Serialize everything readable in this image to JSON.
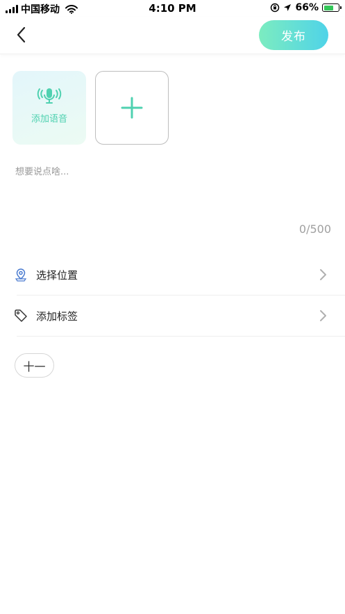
{
  "status_bar": {
    "carrier": "中国移动",
    "time": "4:10 PM",
    "battery_percent": "66%",
    "battery_level": 0.66,
    "icons": [
      "signal-icon",
      "wifi-icon",
      "orientation-lock-icon",
      "location-arrow-icon",
      "battery-icon"
    ]
  },
  "nav": {
    "back_icon": "chevron-left-icon",
    "publish_label": "发布",
    "publish_gradient": [
      "#7cecc0",
      "#4fd3e8"
    ]
  },
  "media": {
    "voice_label": "添加语音",
    "voice_icon": "microphone-icon",
    "add_icon": "plus-icon",
    "accent_color": "#4fd1b0"
  },
  "composer": {
    "placeholder": "想要说点啥...",
    "value": "",
    "char_count": "0/500"
  },
  "options": [
    {
      "label": "选择位置",
      "icon": "location-pin-icon"
    },
    {
      "label": "添加标签",
      "icon": "tag-icon"
    }
  ],
  "chip": {
    "label": "十一"
  }
}
